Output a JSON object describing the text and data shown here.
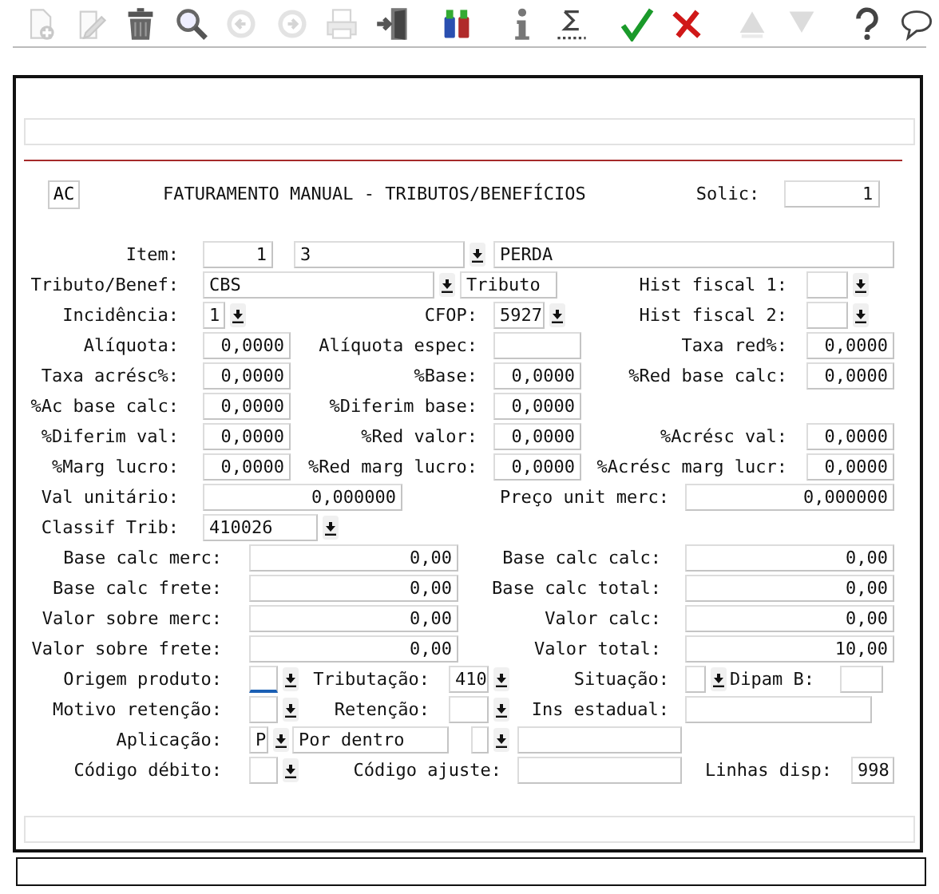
{
  "toolbar": [
    {
      "kind": "new",
      "disabled": true
    },
    {
      "kind": "edit",
      "disabled": true
    },
    {
      "kind": "trash",
      "disabled": false
    },
    {
      "kind": "search",
      "disabled": false
    },
    {
      "kind": "prev",
      "disabled": true
    },
    {
      "kind": "next",
      "disabled": true
    },
    {
      "kind": "print",
      "disabled": true
    },
    {
      "kind": "exit",
      "disabled": false
    },
    {
      "kind": "binoculars",
      "disabled": false
    },
    {
      "kind": "info",
      "disabled": false
    },
    {
      "kind": "sigma",
      "disabled": false
    },
    {
      "kind": "confirm",
      "disabled": false
    },
    {
      "kind": "cancel",
      "disabled": false
    },
    {
      "kind": "up",
      "disabled": true
    },
    {
      "kind": "down",
      "disabled": true
    },
    {
      "kind": "help",
      "disabled": false
    },
    {
      "kind": "comment",
      "disabled": false
    }
  ],
  "header": {
    "button": "AC",
    "title": "FATURAMENTO MANUAL - TRIBUTOS/BENEFÍCIOS",
    "solic_label": "Solic:",
    "solic_value": "1"
  },
  "rows": [
    [
      {
        "kind": "label",
        "text": "Item:"
      },
      {
        "kind": "field",
        "value": "1"
      },
      {
        "kind": "select",
        "value": "3",
        "focused": false
      },
      {
        "kind": "field",
        "value": "PERDA"
      }
    ],
    [
      {
        "kind": "label",
        "text": "Tributo/Benef:"
      },
      {
        "kind": "select",
        "value": "CBS",
        "focused": false
      },
      {
        "kind": "field",
        "value": "Tributo"
      },
      {
        "kind": "label",
        "text": "Hist fiscal 1:"
      },
      {
        "kind": "select",
        "focused": false
      }
    ],
    [
      {
        "kind": "label",
        "text": "Incidência:"
      },
      {
        "kind": "select",
        "value": "1",
        "focused": false
      },
      {
        "kind": "label",
        "text": "CFOP:"
      },
      {
        "kind": "select",
        "value": "5927",
        "focused": false
      },
      {
        "kind": "label",
        "text": "Hist fiscal 2:"
      },
      {
        "kind": "select",
        "focused": false
      }
    ],
    [
      {
        "kind": "label",
        "text": "Alíquota:"
      },
      {
        "kind": "field",
        "value": "0,0000"
      },
      {
        "kind": "label",
        "text": "Alíquota espec:"
      },
      {
        "kind": "field"
      },
      {
        "kind": "label",
        "text": "Taxa red%:"
      },
      {
        "kind": "field",
        "value": "0,0000"
      }
    ],
    [
      {
        "kind": "label",
        "text": "Taxa acrésc%:"
      },
      {
        "kind": "field",
        "value": "0,0000"
      },
      {
        "kind": "label",
        "text": "%Base:"
      },
      {
        "kind": "field",
        "value": "0,0000"
      },
      {
        "kind": "label",
        "text": "%Red base calc:"
      },
      {
        "kind": "field",
        "value": "0,0000"
      }
    ],
    [
      {
        "kind": "label",
        "text": "%Ac base calc:"
      },
      {
        "kind": "field",
        "value": "0,0000"
      },
      {
        "kind": "label",
        "text": "%Diferim base:"
      },
      {
        "kind": "field",
        "value": "0,0000"
      }
    ],
    [
      {
        "kind": "label",
        "text": "%Diferim val:"
      },
      {
        "kind": "field",
        "value": "0,0000"
      },
      {
        "kind": "label",
        "text": "%Red valor:"
      },
      {
        "kind": "field",
        "value": "0,0000"
      },
      {
        "kind": "label",
        "text": "%Acrésc val:"
      },
      {
        "kind": "field",
        "value": "0,0000"
      }
    ],
    [
      {
        "kind": "label",
        "text": "%Marg lucro:"
      },
      {
        "kind": "field",
        "value": "0,0000"
      },
      {
        "kind": "label",
        "text": "%Red marg lucro:"
      },
      {
        "kind": "field",
        "value": "0,0000"
      },
      {
        "kind": "label",
        "text": "%Acrésc marg lucr:"
      },
      {
        "kind": "field",
        "value": "0,0000"
      }
    ],
    [
      {
        "kind": "label",
        "text": "Val unitário:"
      },
      {
        "kind": "field",
        "value": "0,000000"
      },
      {
        "kind": "label",
        "text": "Preço unit merc:"
      },
      {
        "kind": "field",
        "value": "0,000000"
      }
    ],
    [
      {
        "kind": "label",
        "text": "Classif Trib:"
      },
      {
        "kind": "select",
        "value": "410026",
        "focused": false
      }
    ],
    [
      {
        "kind": "label",
        "text": "Base calc merc:"
      },
      {
        "kind": "field",
        "value": "0,00"
      },
      {
        "kind": "label",
        "text": "Base calc calc:"
      },
      {
        "kind": "field",
        "value": "0,00"
      }
    ],
    [
      {
        "kind": "label",
        "text": "Base calc frete:"
      },
      {
        "kind": "field",
        "value": "0,00"
      },
      {
        "kind": "label",
        "text": "Base calc total:"
      },
      {
        "kind": "field",
        "value": "0,00"
      }
    ],
    [
      {
        "kind": "label",
        "text": "Valor sobre merc:"
      },
      {
        "kind": "field",
        "value": "0,00"
      },
      {
        "kind": "label",
        "text": "Valor calc:"
      },
      {
        "kind": "field",
        "value": "0,00"
      }
    ],
    [
      {
        "kind": "label",
        "text": "Valor sobre frete:"
      },
      {
        "kind": "field",
        "value": "0,00"
      },
      {
        "kind": "label",
        "text": "Valor total:"
      },
      {
        "kind": "field",
        "value": "10,00"
      }
    ],
    [
      {
        "kind": "label",
        "text": "Origem produto:"
      },
      {
        "kind": "select",
        "focused": true
      },
      {
        "kind": "label",
        "text": "Tributação:"
      },
      {
        "kind": "select",
        "value": "410",
        "focused": false
      },
      {
        "kind": "label",
        "text": "Situação:"
      },
      {
        "kind": "select",
        "focused": false
      },
      {
        "kind": "label",
        "text": "Dipam B:"
      },
      {
        "kind": "field"
      }
    ],
    [
      {
        "kind": "label",
        "text": "Motivo retenção:"
      },
      {
        "kind": "select",
        "focused": false
      },
      {
        "kind": "label",
        "text": "Retenção:"
      },
      {
        "kind": "select",
        "focused": false
      },
      {
        "kind": "label",
        "text": "Ins estadual:"
      },
      {
        "kind": "field"
      }
    ],
    [
      {
        "kind": "label",
        "text": "Aplicação:"
      },
      {
        "kind": "select",
        "value": "P",
        "focused": false
      },
      {
        "kind": "field",
        "value": "Por dentro"
      },
      {
        "kind": "select",
        "focused": false
      },
      {
        "kind": "field"
      }
    ],
    [
      {
        "kind": "label",
        "text": "Código débito:"
      },
      {
        "kind": "select",
        "focused": false
      },
      {
        "kind": "label",
        "text": "Código ajuste:"
      },
      {
        "kind": "field"
      },
      {
        "kind": "label",
        "text": "Linhas disp:"
      },
      {
        "kind": "field",
        "value": "998"
      }
    ]
  ]
}
